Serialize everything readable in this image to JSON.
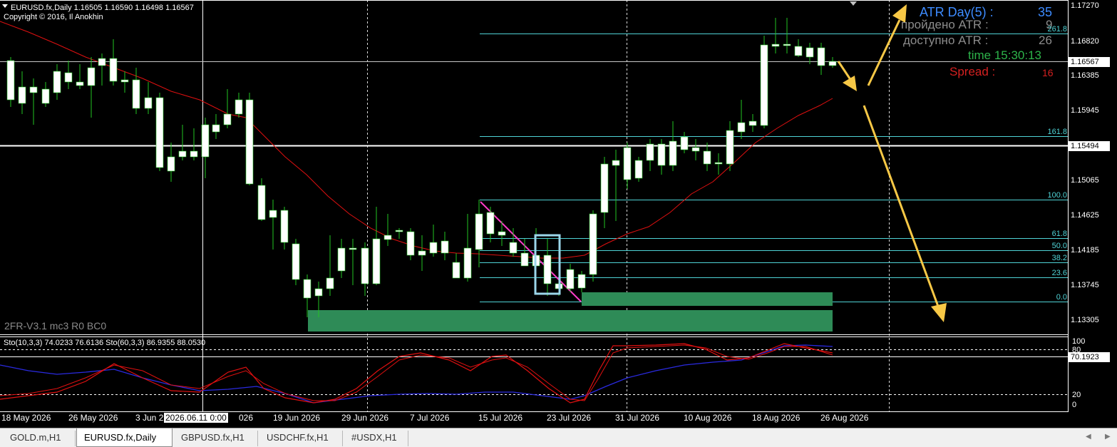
{
  "chart_header": {
    "symbol_line": "EURUSD.fx,Daily  1.16505 1.16590 1.16498 1.16567",
    "copyright": "Copyright © 2016, Il Anokhin",
    "indicator_label": "2FR-V3.1 mc3 R0 BC0"
  },
  "info_panel": {
    "atr_day_label": "ATR Day(5) :",
    "atr_day_value": "35",
    "passed_atr_label": "пройдено ATR :",
    "passed_atr_value": "9",
    "available_atr_label": "доступно ATR :",
    "available_atr_value": "26",
    "time_label": "time 15:30:13",
    "spread_label": "Spread :",
    "spread_value": "16"
  },
  "price_axis": {
    "labels": [
      "1.17270",
      "1.16820",
      "1.16385",
      "1.15945",
      "1.15065",
      "1.14625",
      "1.14185",
      "1.13745",
      "1.13305"
    ],
    "current_price": "1.16567",
    "line_price": "1.15494"
  },
  "fib_levels": [
    "261.8",
    "161.8",
    "100.0",
    "61.8",
    "50.0",
    "38.2",
    "23.6",
    "0.0"
  ],
  "date_axis": {
    "labels": [
      "18 May 2026",
      "26 May 2026",
      "3 Jun 2",
      "19 Jun 2026",
      "29 Jun 2026",
      "7 Jul 2026",
      "15 Jul 2026",
      "23 Jul 2026",
      "31 Jul 2026",
      "10 Aug 2026",
      "18 Aug 2026",
      "26 Aug 2026"
    ],
    "crosshair_date": "2026.06.11 0:00",
    "crosshair_suffix": "026"
  },
  "stochastic": {
    "label": "Sto(10,3,3) 74.0233 76.6136  Sto(60,3,3) 86.9355 88.0530",
    "scale": [
      "100",
      "80",
      "20",
      "0"
    ],
    "current_value": "70.1923"
  },
  "tabs": [
    "GOLD.m,H1",
    "EURUSD.fx,Daily",
    "GBPUSD.fx,H1",
    "USDCHF.fx,H1",
    "#USDX,H1"
  ],
  "active_tab": "EURUSD.fx,Daily",
  "colors": {
    "background": "#000000",
    "bull_candle": "#ffffff",
    "wick": "#22c322",
    "ma": "#e01010",
    "fib": "#4fd3d6",
    "zone": "#2e8b57",
    "arrow": "#f7c846",
    "atr_blue": "#3d8bff",
    "spread_red": "#d42020",
    "time_green": "#2db34a"
  },
  "icons": [
    "dropdown-triangle-icon",
    "scroll-left-icon",
    "scroll-right-icon"
  ]
}
